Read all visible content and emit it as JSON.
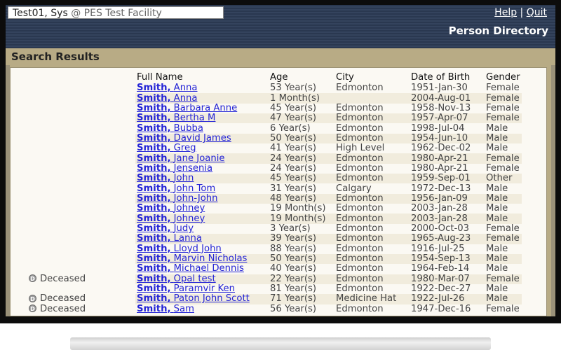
{
  "user": {
    "name": "Test01, Sys",
    "facility": "@ PES Test Facility"
  },
  "links": {
    "help": "Help",
    "separator": "|",
    "quit": "Quit"
  },
  "page_header": "Person Directory",
  "section_title": "Search Results",
  "columns": {
    "full_name": "Full Name",
    "age": "Age",
    "city": "City",
    "dob": "Date of Birth",
    "gender": "Gender"
  },
  "deceased_label": "Deceased",
  "rows": [
    {
      "last": "Smith,",
      "first": "Anna",
      "age": "53 Year(s)",
      "city": "Edmonton",
      "dob": "1951-Jan-30",
      "gender": "Female",
      "deceased": false
    },
    {
      "last": "Smith,",
      "first": "Anna",
      "age": "1 Month(s)",
      "city": "",
      "dob": "2004-Aug-01",
      "gender": "Female",
      "deceased": false
    },
    {
      "last": "Smith,",
      "first": "Barbara Anne",
      "age": "45 Year(s)",
      "city": "Edmonton",
      "dob": "1958-Nov-13",
      "gender": "Female",
      "deceased": false
    },
    {
      "last": "Smith,",
      "first": "Bertha M",
      "age": "47 Year(s)",
      "city": "Edmonton",
      "dob": "1957-Apr-07",
      "gender": "Female",
      "deceased": false
    },
    {
      "last": "Smith,",
      "first": "Bubba",
      "age": "6 Year(s)",
      "city": "Edmonton",
      "dob": "1998-Jul-04",
      "gender": "Male",
      "deceased": false
    },
    {
      "last": "Smith,",
      "first": "David James",
      "age": "50 Year(s)",
      "city": "Edmonton",
      "dob": "1954-Jun-10",
      "gender": "Male",
      "deceased": false
    },
    {
      "last": "Smith,",
      "first": "Greg",
      "age": "41 Year(s)",
      "city": "High Level",
      "dob": "1962-Dec-02",
      "gender": "Male",
      "deceased": false
    },
    {
      "last": "Smith,",
      "first": "Jane Joanie",
      "age": "24 Year(s)",
      "city": "Edmonton",
      "dob": "1980-Apr-21",
      "gender": "Female",
      "deceased": false
    },
    {
      "last": "Smith,",
      "first": "Jensenia",
      "age": "24 Year(s)",
      "city": "Edmonton",
      "dob": "1980-Apr-21",
      "gender": "Female",
      "deceased": false
    },
    {
      "last": "Smith,",
      "first": "John",
      "age": "45 Year(s)",
      "city": "Edmonton",
      "dob": "1959-Sep-01",
      "gender": "Other",
      "deceased": false
    },
    {
      "last": "Smith,",
      "first": "John Tom",
      "age": "31 Year(s)",
      "city": "Calgary",
      "dob": "1972-Dec-13",
      "gender": "Male",
      "deceased": false
    },
    {
      "last": "Smith,",
      "first": "John-John",
      "age": "48 Year(s)",
      "city": "Edmonton",
      "dob": "1956-Jan-09",
      "gender": "Male",
      "deceased": false
    },
    {
      "last": "Smith,",
      "first": "Johney",
      "age": "19 Month(s)",
      "city": "Edmonton",
      "dob": "2003-Jan-28",
      "gender": "Male",
      "deceased": false
    },
    {
      "last": "Smith,",
      "first": "Johney",
      "age": "19 Month(s)",
      "city": "Edmonton",
      "dob": "2003-Jan-28",
      "gender": "Male",
      "deceased": false
    },
    {
      "last": "Smith,",
      "first": "Judy",
      "age": "3 Year(s)",
      "city": "Edmonton",
      "dob": "2000-Oct-03",
      "gender": "Female",
      "deceased": false
    },
    {
      "last": "Smith,",
      "first": "Lanna",
      "age": "39 Year(s)",
      "city": "Edmonton",
      "dob": "1965-Aug-23",
      "gender": "Female",
      "deceased": false
    },
    {
      "last": "Smith,",
      "first": "Lloyd John",
      "age": "88 Year(s)",
      "city": "Edmonton",
      "dob": "1916-Jul-25",
      "gender": "Male",
      "deceased": false
    },
    {
      "last": "Smith,",
      "first": "Marvin Nicholas",
      "age": "50 Year(s)",
      "city": "Edmonton",
      "dob": "1954-Sep-13",
      "gender": "Male",
      "deceased": false
    },
    {
      "last": "Smith,",
      "first": "Michael Dennis",
      "age": "40 Year(s)",
      "city": "Edmonton",
      "dob": "1964-Feb-14",
      "gender": "Male",
      "deceased": false
    },
    {
      "last": "Smith,",
      "first": "Opal test",
      "age": "22 Year(s)",
      "city": "Edmonton",
      "dob": "1980-Mar-07",
      "gender": "Female",
      "deceased": true
    },
    {
      "last": "Smith,",
      "first": "Paramvir Ken",
      "age": "81 Year(s)",
      "city": "Edmonton",
      "dob": "1922-Dec-27",
      "gender": "Male",
      "deceased": false
    },
    {
      "last": "Smith,",
      "first": "Paton John Scott",
      "age": "71 Year(s)",
      "city": "Medicine Hat",
      "dob": "1922-Jul-26",
      "gender": "Male",
      "deceased": true
    },
    {
      "last": "Smith,",
      "first": "Sam",
      "age": "56 Year(s)",
      "city": "Edmonton",
      "dob": "1947-Dec-16",
      "gender": "Female",
      "deceased": true
    }
  ]
}
